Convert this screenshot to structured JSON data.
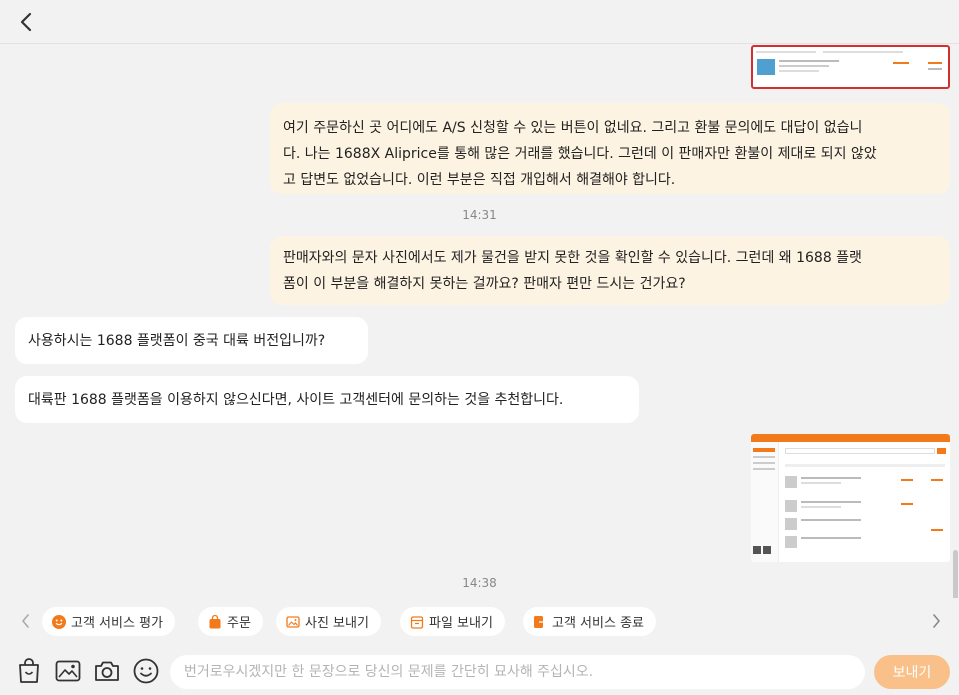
{
  "header": {
    "back_icon": "chevron-left-icon"
  },
  "messages": [
    {
      "id": "m1",
      "sender": "user",
      "type": "image",
      "alt": ""
    },
    {
      "id": "m2",
      "sender": "user",
      "type": "text",
      "lines": [
        "여기 주문하신 곳 어디에도 A/S 신청할 수 있는 버튼이 없네요. 그리고 환불 문의에도 대답이 없습니",
        "다. 나는 1688X Aliprice를 통해 많은 거래를 했습니다. 그런데 이 판매자만 환불이 제대로 되지 않았",
        "고 답변도 없었습니다. 이런 부분은 직접 개입해서 해결해야 합니다."
      ]
    },
    {
      "id": "t1",
      "type": "timestamp",
      "time": "14:31"
    },
    {
      "id": "m3",
      "sender": "user",
      "type": "text",
      "lines": [
        "판매자와의 문자 사진에서도 제가 물건을 받지 못한 것을 확인할 수 있습니다. 그런데 왜 1688 플랫",
        "폼이 이 부분을 해결하지 못하는 걸까요? 판매자 편만 드시는 건가요?"
      ]
    },
    {
      "id": "m4",
      "sender": "agent",
      "type": "text",
      "lines": [
        "사용하시는 1688 플랫폼이 중국 대륙 버전입니까?"
      ]
    },
    {
      "id": "m5",
      "sender": "agent",
      "type": "text",
      "lines": [
        "대륙판 1688 플랫폼을 이용하지 않으신다면, 사이트 고객센터에 문의하는 것을 추천합니다."
      ]
    },
    {
      "id": "m6",
      "sender": "user",
      "type": "image",
      "alt": ""
    },
    {
      "id": "t2",
      "type": "timestamp",
      "time": "14:38"
    }
  ],
  "quick_actions": [
    {
      "label": "고객 서비스 평가",
      "icon": "smiley-icon"
    },
    {
      "label": "주문",
      "icon": "shopping-bag-icon"
    },
    {
      "label": "사진 보내기",
      "icon": "image-icon"
    },
    {
      "label": "파일 보내기",
      "icon": "file-icon"
    },
    {
      "label": "고객 서비스 종료",
      "icon": "exit-icon"
    }
  ],
  "toolbar": {
    "tools": [
      "order-bag-icon",
      "picture-icon",
      "camera-icon",
      "emoji-icon"
    ]
  },
  "composer": {
    "placeholder": "번거로우시겠지만 한 문장으로 당신의 문제를 간단히 묘사해 주십시오.",
    "value": "",
    "send_label": "보내기"
  },
  "colors": {
    "accent": "#f27a1a",
    "send_disabled": "#f9c089",
    "user_bubble": "#fdf3e2",
    "agent_bubble": "#ffffff",
    "background": "#f2f2f2"
  }
}
